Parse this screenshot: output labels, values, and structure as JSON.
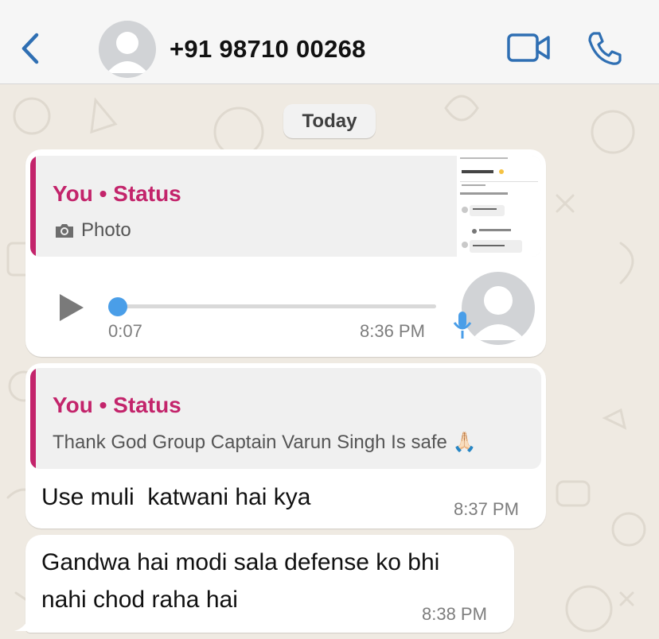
{
  "header": {
    "contact_name": "+91 98710 00268",
    "back_icon": "chevron-left-icon",
    "video_icon": "video-camera-icon",
    "call_icon": "phone-icon",
    "accent_color": "#2f6fb3"
  },
  "date_pill": "Today",
  "messages": [
    {
      "type": "voice",
      "quote": {
        "title": "You • Status",
        "subtitle": "Photo",
        "subtitle_icon": "camera-icon"
      },
      "voice": {
        "duration": "0:07",
        "progress": 0
      },
      "time": "8:36 PM"
    },
    {
      "type": "text",
      "quote": {
        "title": "You • Status",
        "subtitle": "Thank God Group Captain Varun Singh Is safe 🙏🏻"
      },
      "text": "Use muli  katwani hai kya",
      "time": "8:37 PM"
    },
    {
      "type": "text",
      "text_lines": [
        "Gandwa hai modi sala defense ko bhi",
        "nahi chod raha hai"
      ],
      "time": "8:38 PM"
    }
  ],
  "colors": {
    "status_pink": "#c3246b",
    "voice_blue": "#4a9ee8"
  }
}
